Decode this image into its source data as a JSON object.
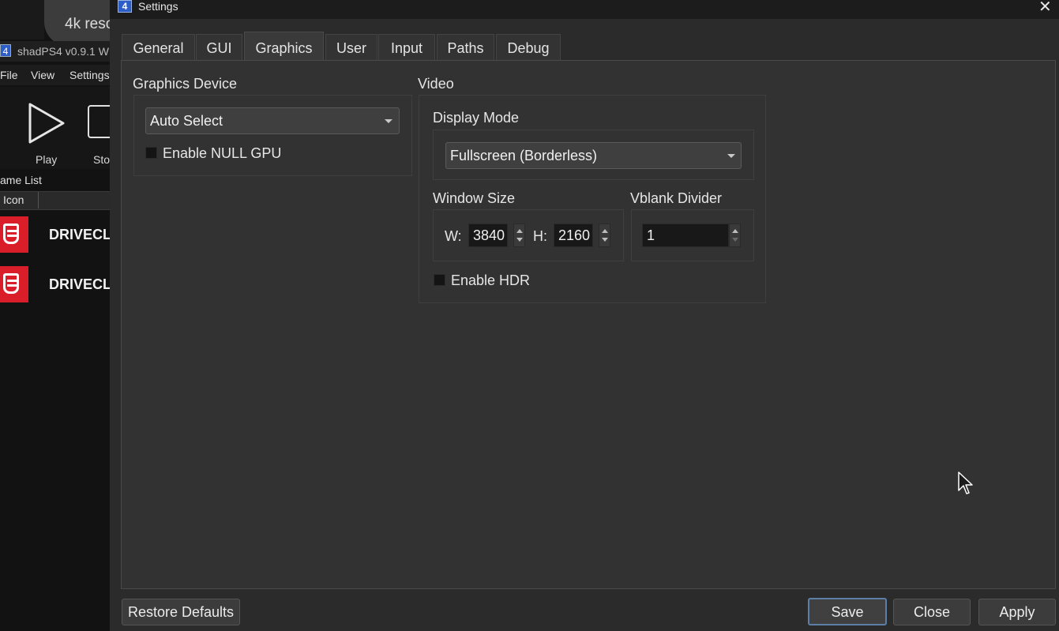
{
  "background_window": {
    "tab_pill_text": "4k reso",
    "title": "shadPS4 v0.9.1 W",
    "menu": [
      "File",
      "View",
      "Settings"
    ],
    "toolbar": {
      "play_label": "Play",
      "stop_label": "Sto"
    },
    "game_list_label": "ame List",
    "table_header_icon": "Icon",
    "rows": [
      {
        "title": "DRIVECL",
        "icon": "drive-club-icon"
      },
      {
        "title": "DRIVECL",
        "icon": "drive-club-icon"
      }
    ]
  },
  "dialog": {
    "title": "Settings",
    "app_icon_text": "4",
    "close_icon": "close-icon",
    "tabs": [
      {
        "label": "General"
      },
      {
        "label": "GUI"
      },
      {
        "label": "Graphics",
        "active": true
      },
      {
        "label": "User"
      },
      {
        "label": "Input"
      },
      {
        "label": "Paths"
      },
      {
        "label": "Debug"
      }
    ],
    "graphics_device": {
      "title": "Graphics Device",
      "selected": "Auto Select",
      "null_gpu_label": "Enable NULL GPU",
      "null_gpu_checked": false
    },
    "video": {
      "title": "Video",
      "display_mode_title": "Display Mode",
      "display_mode_selected": "Fullscreen (Borderless)",
      "window_size_title": "Window Size",
      "width_label": "W:",
      "width_value": "3840",
      "height_label": "H:",
      "height_value": "2160",
      "vblank_title": "Vblank Divider",
      "vblank_value": "1",
      "hdr_label": "Enable HDR",
      "hdr_checked": false
    },
    "buttons": {
      "restore_defaults": "Restore Defaults",
      "save": "Save",
      "close": "Close",
      "apply": "Apply"
    }
  }
}
